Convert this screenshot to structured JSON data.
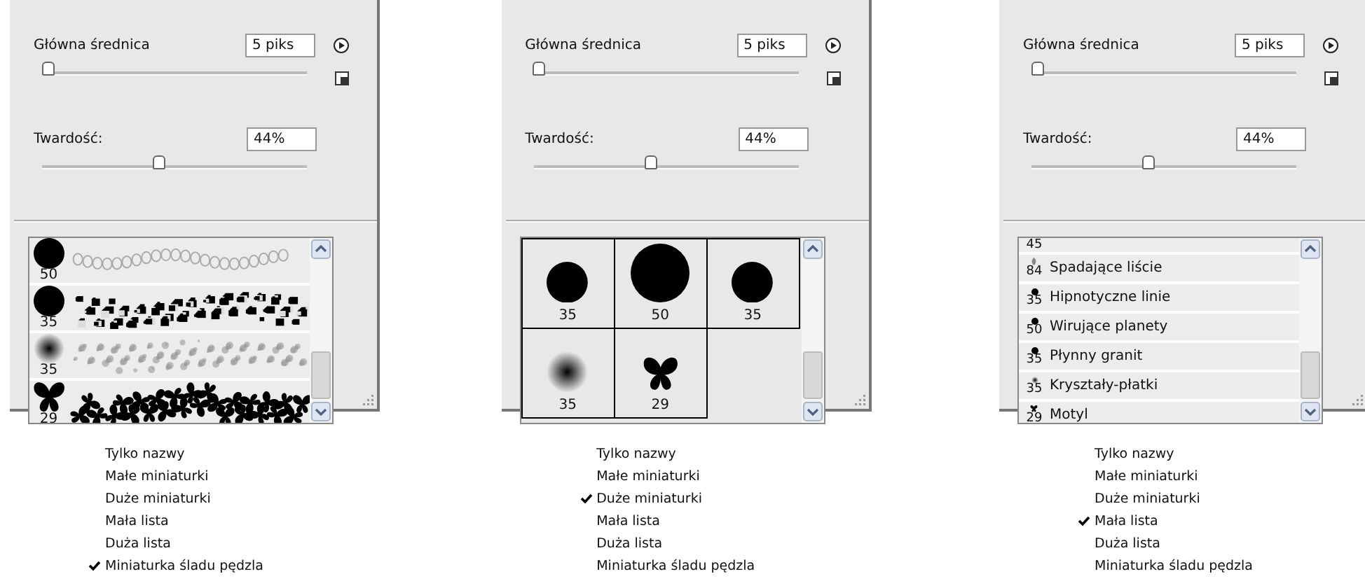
{
  "panels": [
    {
      "diameter": {
        "label": "Główna średnica",
        "value": "5 piks",
        "level": 0.02
      },
      "hardness": {
        "label": "Twardość:",
        "value": "44%",
        "level": 0.44
      },
      "view": {
        "kind": "stroke",
        "items": [
          {
            "size": "50",
            "kind": "hard",
            "stroke": {
              "kind": "chain"
            }
          },
          {
            "size": "35",
            "kind": "hard",
            "stroke": {
              "kind": "spatter"
            }
          },
          {
            "size": "35",
            "kind": "soft",
            "stroke": {
              "kind": "soft-spatter"
            }
          },
          {
            "size": "29",
            "kind": "butterfly",
            "stroke": {
              "kind": "butterflies"
            }
          }
        ]
      },
      "menu": [
        {
          "label": "Tylko nazwy",
          "selected": false
        },
        {
          "label": "Małe miniaturki",
          "selected": false
        },
        {
          "label": "Duże miniaturki",
          "selected": false
        },
        {
          "label": "Mała lista",
          "selected": false
        },
        {
          "label": "Duża lista",
          "selected": false
        },
        {
          "label": "Miniaturka śladu pędzla",
          "selected": true
        }
      ]
    },
    {
      "diameter": {
        "label": "Główna średnica",
        "value": "5 piks",
        "level": 0.02
      },
      "hardness": {
        "label": "Twardość:",
        "value": "44%",
        "level": 0.44
      },
      "view": {
        "kind": "thumbs",
        "items": [
          {
            "size": "35",
            "kind": "hard"
          },
          {
            "size": "50",
            "kind": "hard"
          },
          {
            "size": "35",
            "kind": "hard"
          },
          {
            "size": "35",
            "kind": "soft"
          },
          {
            "size": "29",
            "kind": "butterfly"
          }
        ]
      },
      "menu": [
        {
          "label": "Tylko nazwy",
          "selected": false
        },
        {
          "label": "Małe miniaturki",
          "selected": false
        },
        {
          "label": "Duże miniaturki",
          "selected": true
        },
        {
          "label": "Mała lista",
          "selected": false
        },
        {
          "label": "Duża lista",
          "selected": false
        },
        {
          "label": "Miniaturka śladu pędzla",
          "selected": false
        }
      ]
    },
    {
      "diameter": {
        "label": "Główna średnica",
        "value": "5 piks",
        "level": 0.02
      },
      "hardness": {
        "label": "Twardość:",
        "value": "44%",
        "level": 0.44
      },
      "view": {
        "kind": "list",
        "items": [
          {
            "size": "45"
          },
          {
            "size": "84",
            "kind": "leaf",
            "name": "Spadające liście"
          },
          {
            "size": "35",
            "kind": "hard",
            "name": "Hipnotyczne linie"
          },
          {
            "size": "50",
            "kind": "hard",
            "name": "Wirujące planety"
          },
          {
            "size": "35",
            "kind": "hard",
            "name": "Płynny granit"
          },
          {
            "size": "35",
            "kind": "soft",
            "name": "Kryształy-płatki"
          },
          {
            "size": "29",
            "kind": "butterfly",
            "name": "Motyl"
          }
        ]
      },
      "menu": [
        {
          "label": "Tylko nazwy",
          "selected": false
        },
        {
          "label": "Małe miniaturki",
          "selected": false
        },
        {
          "label": "Duże miniaturki",
          "selected": false
        },
        {
          "label": "Mała lista",
          "selected": true
        },
        {
          "label": "Duża lista",
          "selected": false
        },
        {
          "label": "Miniaturka śladu pędzla",
          "selected": false
        }
      ]
    }
  ]
}
